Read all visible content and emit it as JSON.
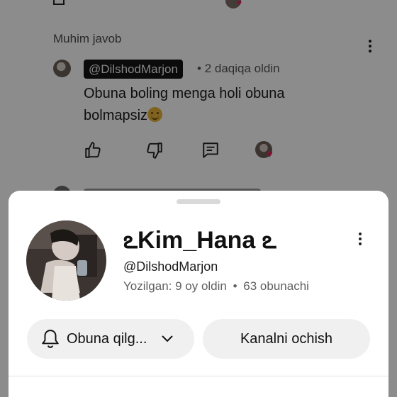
{
  "comments_page": {
    "section_label": "Muhim javob",
    "comment": {
      "author_handle": "@DilshodMarjon",
      "separator": "•",
      "time": "2 daqiqa oldin",
      "text": "Obuna boling menga holi obuna bolmapsiz",
      "emoji": "smiling-face-emoji"
    },
    "actions": [
      "like-icon",
      "dislike-icon",
      "reply-icon"
    ],
    "heart_color": "#e0245e"
  },
  "channel_sheet": {
    "name": "ఽKim_Hana ఽ",
    "handle": "@DilshodMarjon",
    "meta": {
      "joined": "Yozilgan: 9 oy oldin",
      "separator": "•",
      "subscribers": "63 obunachi"
    },
    "subscribe_button": {
      "label": "Obuna qilg...",
      "icon": "bell-icon",
      "dropdown_icon": "chevron-down-icon"
    },
    "open_channel_button": {
      "label": "Kanalni ochish"
    }
  },
  "colors": {
    "scrim": "rgba(0,0,0,0.45)",
    "sheet_bg": "#ffffff",
    "button_bg": "#f0f0f0",
    "handle_pill_bg": "#151515"
  }
}
